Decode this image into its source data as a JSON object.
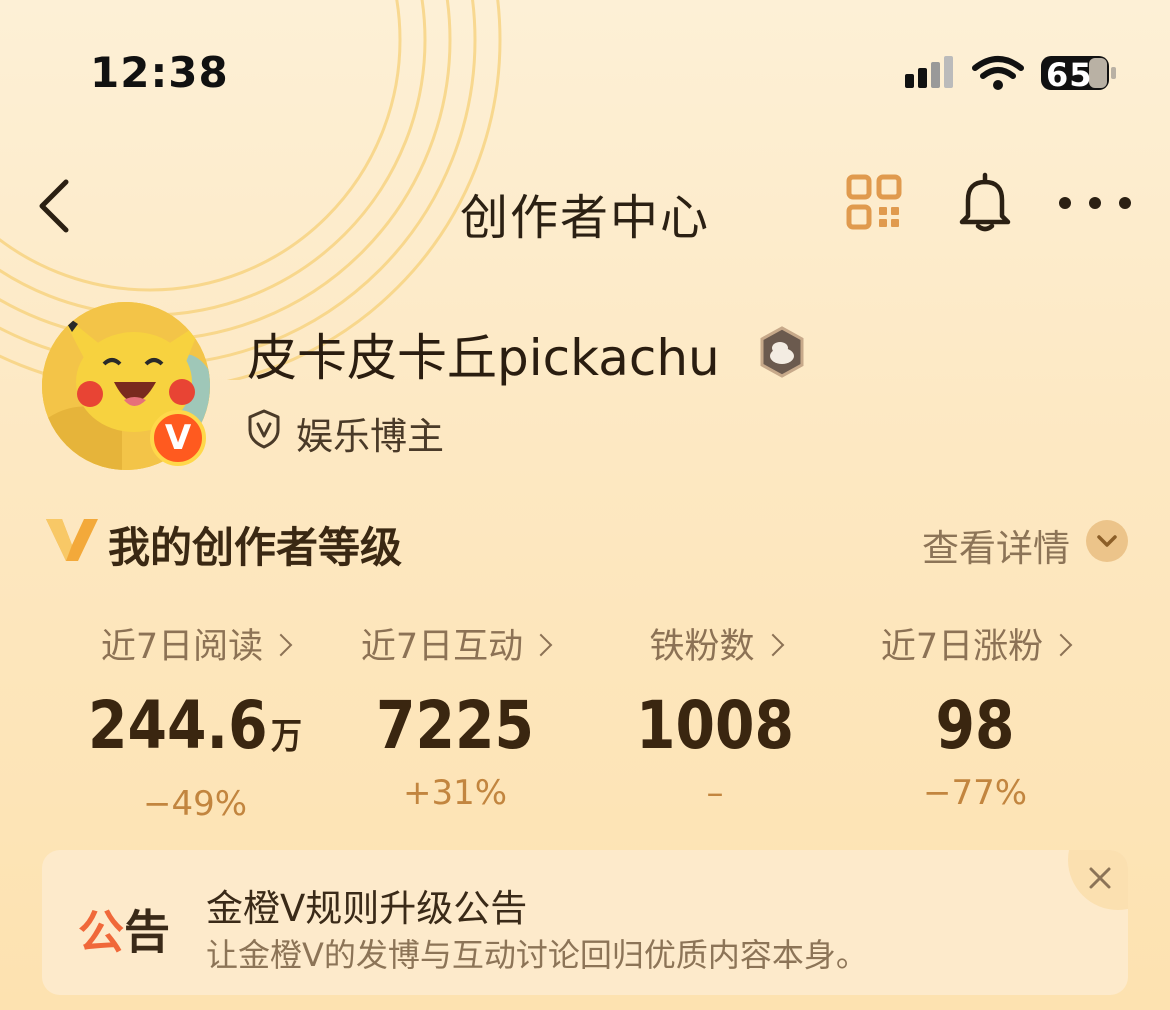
{
  "status_bar": {
    "time": "12:38",
    "battery": "65"
  },
  "nav": {
    "title": "创作者中心"
  },
  "profile": {
    "username": "皮卡皮卡丘pickachu",
    "badge_letter": "V",
    "role": "娱乐博主"
  },
  "level": {
    "title": "我的创作者等级",
    "details_link": "查看详情"
  },
  "stats": [
    {
      "label": "近7日阅读",
      "value": "244.6",
      "unit": "万",
      "change": "−49%"
    },
    {
      "label": "近7日互动",
      "value": "7225",
      "unit": "",
      "change": "+31%"
    },
    {
      "label": "铁粉数",
      "value": "1008",
      "unit": "",
      "change": "–"
    },
    {
      "label": "近7日涨粉",
      "value": "98",
      "unit": "",
      "change": "−77%"
    }
  ],
  "notice": {
    "tag_first": "公",
    "tag_second": "告",
    "title": "金橙V规则升级公告",
    "subtitle": "让金橙V的发博与互动讨论回归优质内容本身。"
  },
  "colors": {
    "accent_orange": "#f0683a",
    "gold": "#f3a93a",
    "brown_text": "#3a2610"
  },
  "icons": [
    "back-chevron-icon",
    "qr-code-icon",
    "bell-icon",
    "more-dots-icon",
    "medal-icon",
    "shield-v-icon",
    "gold-v-icon",
    "chevron-down-icon",
    "close-icon"
  ]
}
